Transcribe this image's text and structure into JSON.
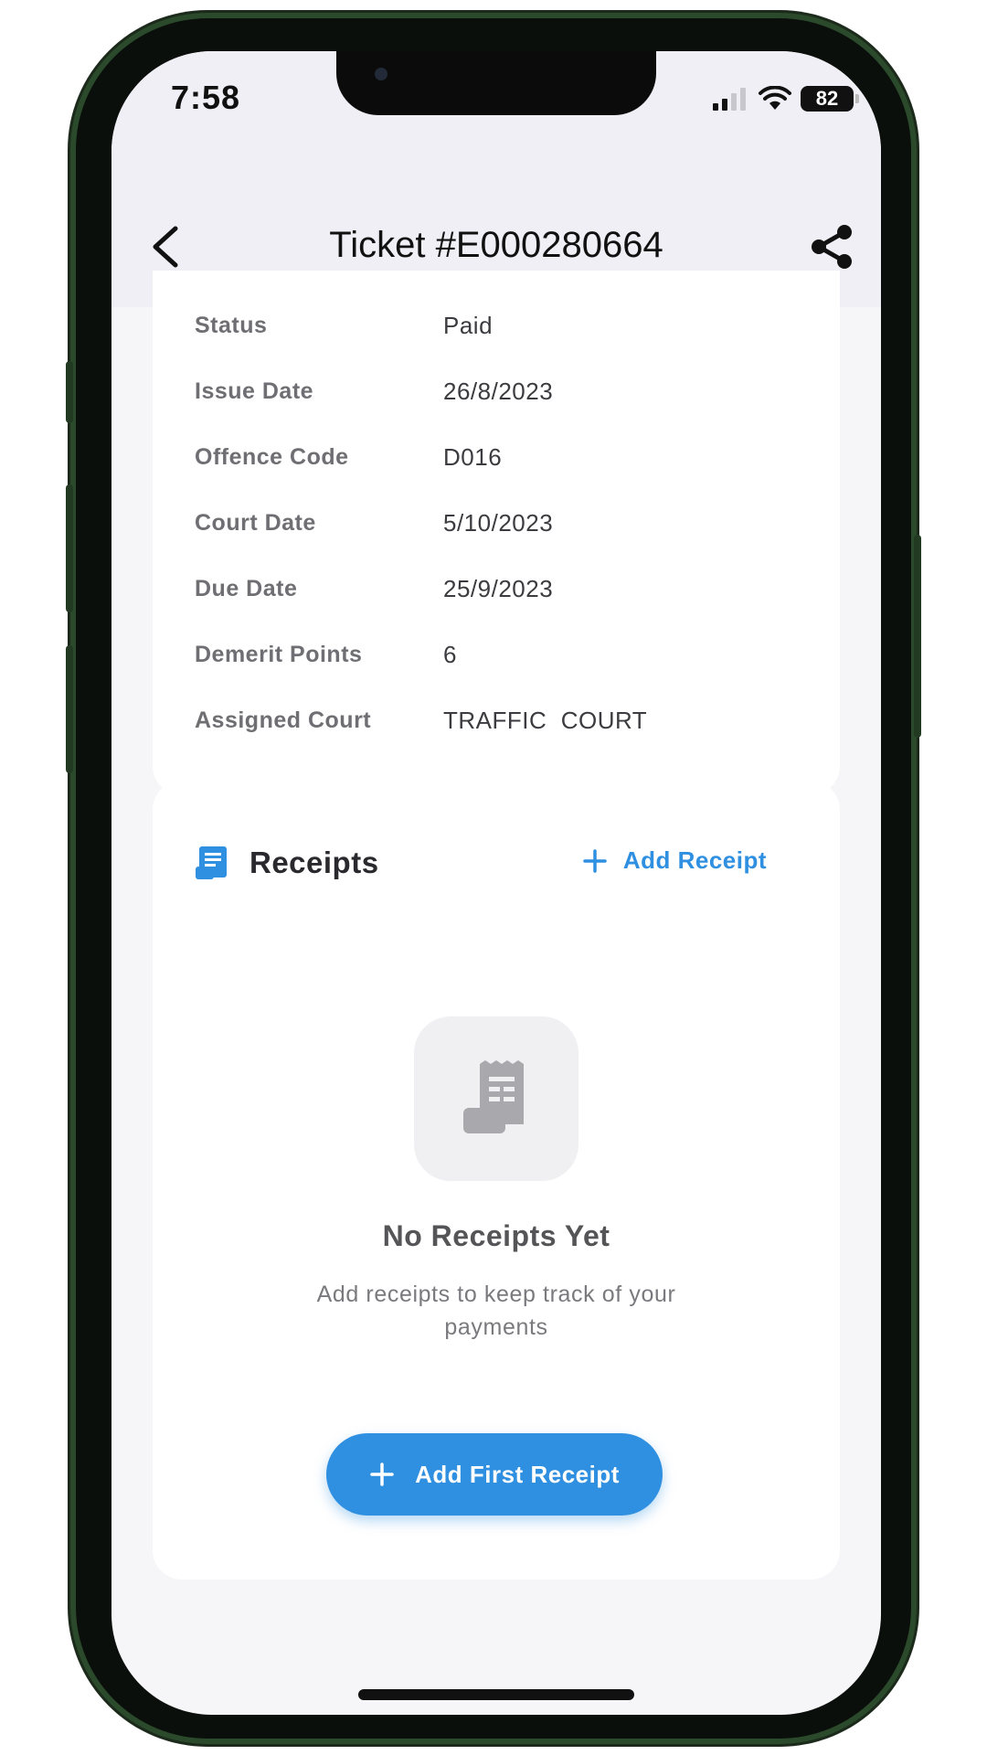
{
  "status_bar": {
    "time": "7:58",
    "battery": "82"
  },
  "nav": {
    "title": "Ticket #E000280664",
    "back_icon": "chevron-left-icon",
    "share_icon": "share-icon"
  },
  "details": [
    {
      "label": "Status",
      "value": "Paid"
    },
    {
      "label": "Issue Date",
      "value": "26/8/2023"
    },
    {
      "label": "Offence Code",
      "value": "D016"
    },
    {
      "label": "Court Date",
      "value": "5/10/2023"
    },
    {
      "label": "Due Date",
      "value": "25/9/2023"
    },
    {
      "label": "Demerit Points",
      "value": "6"
    },
    {
      "label": "Assigned Court",
      "value": "TRAFFIC  COURT"
    }
  ],
  "receipts": {
    "title": "Receipts",
    "add_link": "Add Receipt",
    "empty_title": "No Receipts Yet",
    "empty_subtitle": "Add receipts to keep track of your payments",
    "add_first_button": "Add First Receipt"
  },
  "colors": {
    "accent": "#2f8fe0",
    "header_bg": "#efeff5",
    "page_bg": "#f6f6f9"
  }
}
